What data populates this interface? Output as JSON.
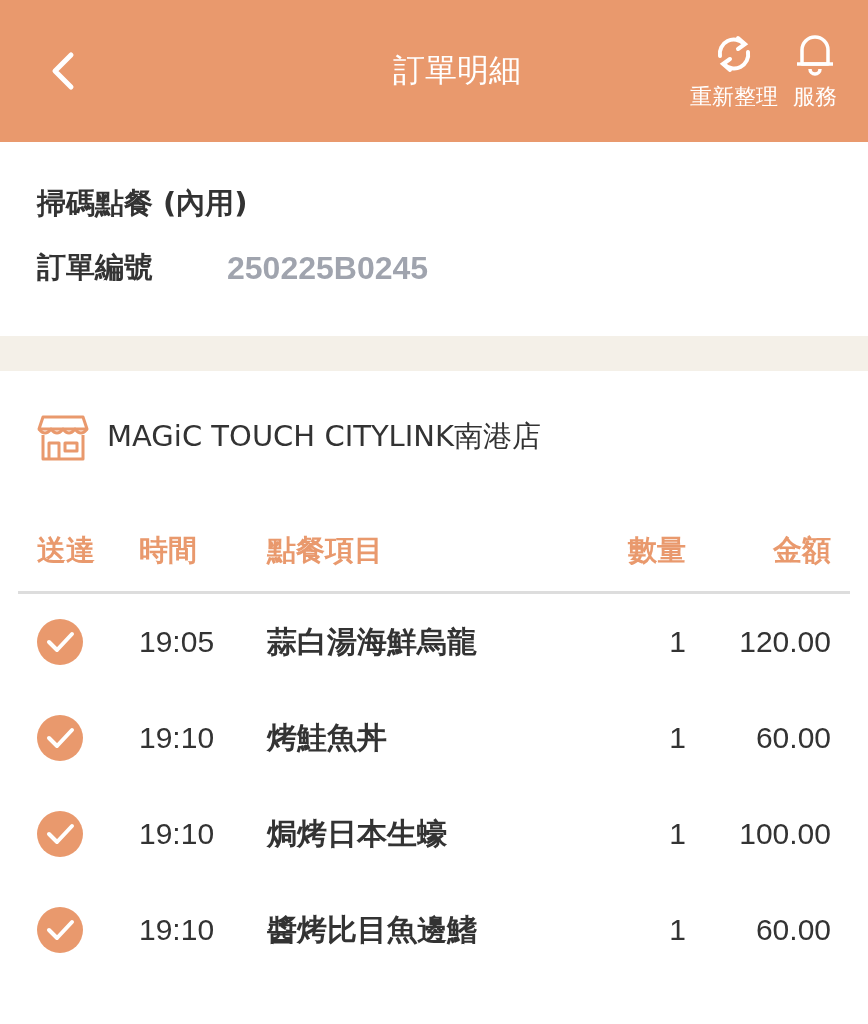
{
  "header": {
    "title": "訂單明細",
    "actions": [
      {
        "kind": "refresh",
        "label": "重新整理"
      },
      {
        "kind": "bell",
        "label": "服務"
      }
    ]
  },
  "order": {
    "type": "掃碼點餐 (內用)",
    "number_label": "訂單編號",
    "number": "250225B0245"
  },
  "store": {
    "name": "MAGiC TOUCH CITYLINK南港店"
  },
  "table": {
    "columns": [
      "送達",
      "時間",
      "點餐項目",
      "數量",
      "金額"
    ],
    "rows": [
      {
        "delivered": true,
        "time": "19:05",
        "item": "蒜白湯海鮮烏龍",
        "qty": "1",
        "amount": "120.00"
      },
      {
        "delivered": true,
        "time": "19:10",
        "item": "烤鮭魚丼",
        "qty": "1",
        "amount": "60.00"
      },
      {
        "delivered": true,
        "time": "19:10",
        "item": "焗烤日本生蠔",
        "qty": "1",
        "amount": "100.00"
      },
      {
        "delivered": true,
        "time": "19:10",
        "item": "醬烤比目魚邊鰭",
        "qty": "1",
        "amount": "60.00"
      }
    ]
  }
}
